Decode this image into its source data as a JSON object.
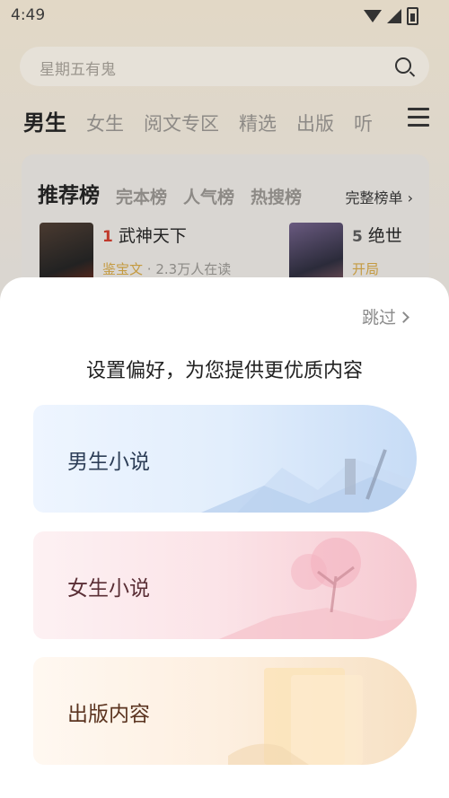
{
  "status": {
    "time": "4:49"
  },
  "search": {
    "placeholder": "星期五有鬼"
  },
  "tabs": [
    "男生",
    "女生",
    "阅文专区",
    "精选",
    "出版",
    "听"
  ],
  "rank": {
    "tabs": [
      "推荐榜",
      "完本榜",
      "人气榜",
      "热搜榜"
    ],
    "more": "完整榜单",
    "books": [
      {
        "rank": "1",
        "title": "武神天下",
        "author": "鉴宝文",
        "readers": "· 2.3万人在读"
      },
      {
        "rank": "5",
        "title": "绝世",
        "author": "开局",
        "readers": ""
      }
    ]
  },
  "sheet": {
    "skip": "跳过",
    "title": "设置偏好，为您提供更优质内容",
    "options": [
      "男生小说",
      "女生小说",
      "出版内容"
    ]
  }
}
